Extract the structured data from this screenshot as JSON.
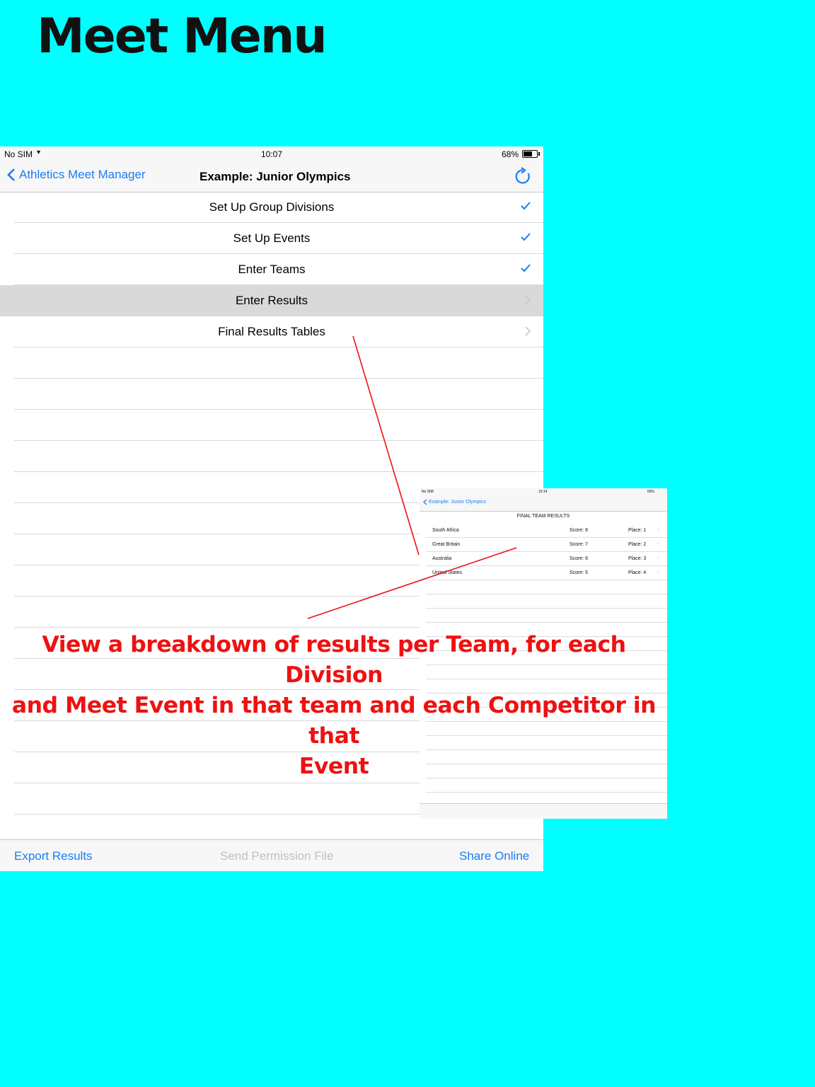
{
  "heading": "Meet Menu",
  "status_bar": {
    "carrier": "No SIM",
    "time": "10:07",
    "battery": "68%"
  },
  "nav": {
    "back_label": "Athletics Meet Manager",
    "title": "Example: Junior Olympics"
  },
  "menu": {
    "items": [
      {
        "label": "Set Up Group Divisions",
        "accessory": "checkmark"
      },
      {
        "label": "Set Up Events",
        "accessory": "checkmark"
      },
      {
        "label": "Enter Teams",
        "accessory": "checkmark"
      },
      {
        "label": "Enter Results",
        "accessory": "chevron",
        "selected": true
      },
      {
        "label": "Final Results Tables",
        "accessory": "chevron"
      }
    ]
  },
  "toolbar": {
    "export_label": "Export Results",
    "permission_label": "Send Permission File",
    "share_label": "Share Online"
  },
  "inset": {
    "status_bar": {
      "carrier": "No SIM",
      "time": "10:14",
      "battery": "65%"
    },
    "back_label": "Example: Junior Olympics",
    "header": "FINAL TEAM RESULTS",
    "rows": [
      {
        "team": "South Africa",
        "score": "Score: 8",
        "place": "Place: 1"
      },
      {
        "team": "Great Britain",
        "score": "Score: 7",
        "place": "Place: 2"
      },
      {
        "team": "Australia",
        "score": "Score: 6",
        "place": "Place: 3"
      },
      {
        "team": "United States",
        "score": "Score: 5",
        "place": "Place: 4"
      }
    ]
  },
  "caption": {
    "line1": "View a breakdown of results per Team, for each Division",
    "line2": "and Meet Event in that team and each Competitor in that",
    "line3": "Event"
  },
  "colors": {
    "background": "#00ffff",
    "accent": "#1a7cf5",
    "annotation": "#ee1111"
  }
}
